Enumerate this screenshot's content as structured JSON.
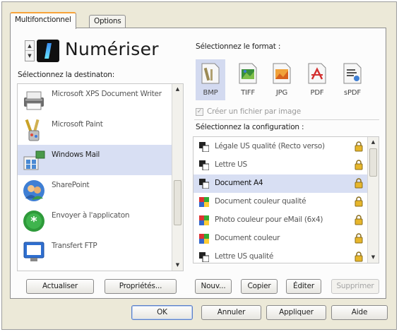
{
  "tabs": [
    {
      "label": "Multifonctionnel",
      "active": true
    },
    {
      "label": "Options",
      "active": false
    }
  ],
  "function_title": "Numériser",
  "destination": {
    "label": "Sélectionnez la destinaton:",
    "items": [
      {
        "label": "Microsoft XPS Document Writer",
        "icon": "printer-icon",
        "selected": false
      },
      {
        "label": "Microsoft Paint",
        "icon": "paint-brush-icon",
        "selected": false
      },
      {
        "label": "Windows Mail",
        "icon": "windows-mail-icon",
        "selected": true
      },
      {
        "label": "SharePoint",
        "icon": "sharepoint-icon",
        "selected": false
      },
      {
        "label": "Envoyer à l'applicaton",
        "icon": "send-to-application-icon",
        "selected": false
      },
      {
        "label": "Transfert FTP",
        "icon": "ftp-transfer-icon",
        "selected": false
      }
    ]
  },
  "format": {
    "label": "Sélectionnez le format :",
    "items": [
      {
        "label": "BMP",
        "icon": "bmp-file-icon",
        "selected": true
      },
      {
        "label": "TIFF",
        "icon": "tiff-file-icon",
        "selected": false
      },
      {
        "label": "JPG",
        "icon": "jpg-file-icon",
        "selected": false
      },
      {
        "label": "PDF",
        "icon": "pdf-file-icon",
        "selected": false
      },
      {
        "label": "sPDF",
        "icon": "spdf-file-icon",
        "selected": false
      }
    ],
    "create_file_per_image": {
      "label": "Créer un fichier par image",
      "checked": true,
      "disabled": true
    }
  },
  "configuration": {
    "label": "Sélectionnez la configuration :",
    "items": [
      {
        "label": "Légale US qualité (Recto verso)",
        "icon": "bw-document-icon",
        "selected": false
      },
      {
        "label": "Lettre US",
        "icon": "bw-document-icon",
        "selected": false
      },
      {
        "label": "Document A4",
        "icon": "bw-document-icon",
        "selected": true
      },
      {
        "label": "Document couleur qualité",
        "icon": "color-document-icon",
        "selected": false
      },
      {
        "label": "Photo couleur pour eMail (6x4)",
        "icon": "color-document-icon",
        "selected": false
      },
      {
        "label": "Document couleur",
        "icon": "color-document-icon",
        "selected": false
      },
      {
        "label": "Lettre US qualité",
        "icon": "bw-document-icon",
        "selected": false
      }
    ]
  },
  "left_buttons": {
    "refresh": "Actualiser",
    "properties": "Propriétés..."
  },
  "config_buttons": {
    "new": "Nouv...",
    "copy": "Copier",
    "edit": "Éditer",
    "delete": "Supprimer"
  },
  "dialog_buttons": {
    "ok": "OK",
    "cancel": "Annuler",
    "apply": "Appliquer",
    "help": "Aide"
  },
  "colors": {
    "selection": "#d8dff3",
    "window": "#ece9d8",
    "tab_accent": "#f8a33a"
  }
}
